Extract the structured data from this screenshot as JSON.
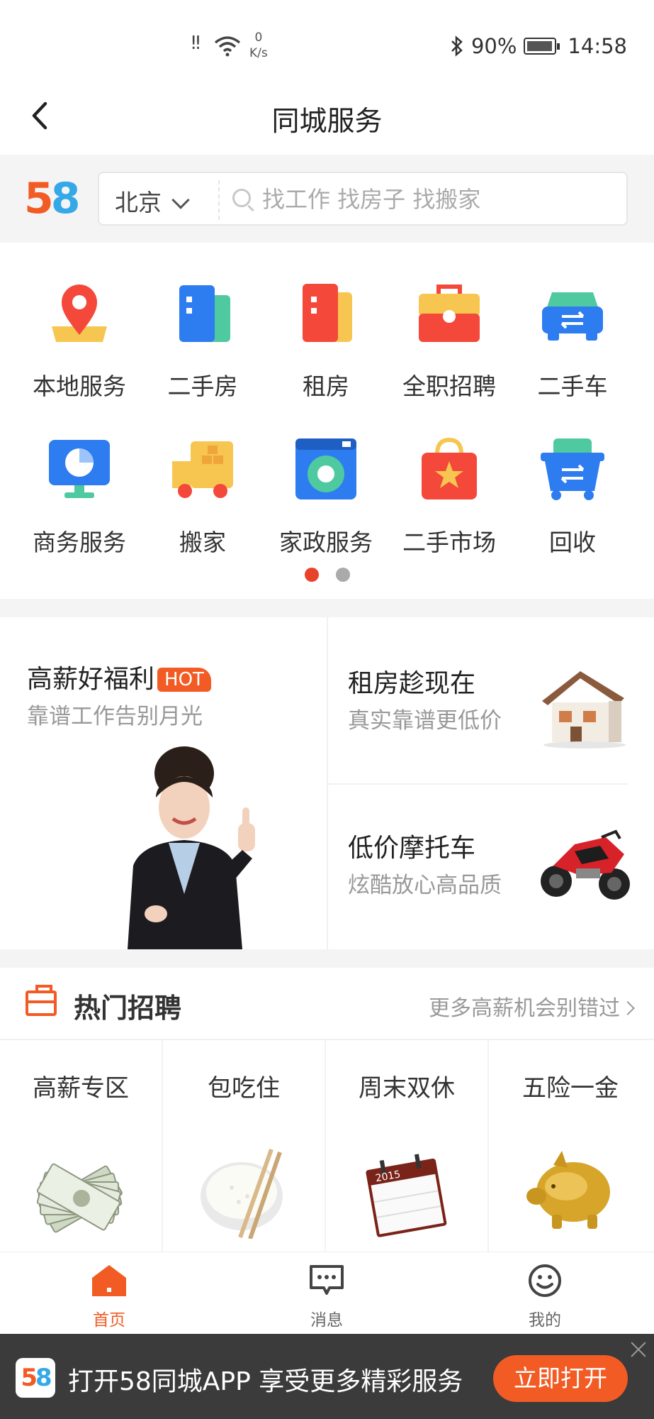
{
  "status_bar": {
    "net": "‼",
    "speed_value": "0",
    "speed_unit": "K/s",
    "battery": "90%",
    "time": "14:58"
  },
  "header": {
    "title": "同城服务"
  },
  "search": {
    "logo": "58",
    "city": "北京",
    "placeholder": "找工作 找房子 找搬家"
  },
  "categories": [
    {
      "label": "本地服务",
      "icon": "location-pin-icon"
    },
    {
      "label": "二手房",
      "icon": "buildings-icon"
    },
    {
      "label": "租房",
      "icon": "rental-building-icon"
    },
    {
      "label": "全职招聘",
      "icon": "briefcase-icon"
    },
    {
      "label": "二手车",
      "icon": "car-icon"
    },
    {
      "label": "商务服务",
      "icon": "monitor-chart-icon"
    },
    {
      "label": "搬家",
      "icon": "moving-truck-icon"
    },
    {
      "label": "家政服务",
      "icon": "washing-machine-icon"
    },
    {
      "label": "二手市场",
      "icon": "shopping-bag-star-icon"
    },
    {
      "label": "回收",
      "icon": "recycle-cart-icon"
    }
  ],
  "pager": {
    "active": 1,
    "total": 2
  },
  "promos": {
    "left": {
      "title": "高薪好福利",
      "badge": "HOT",
      "subtitle": "靠谱工作告别月光"
    },
    "right_top": {
      "title": "租房趁现在",
      "subtitle": "真实靠谱更低价"
    },
    "right_bottom": {
      "title": "低价摩托车",
      "subtitle": "炫酷放心高品质"
    }
  },
  "hot_jobs": {
    "title": "热门招聘",
    "more": "更多高薪机会别错过",
    "items": [
      {
        "label": "高薪专区",
        "icon": "money-icon"
      },
      {
        "label": "包吃住",
        "icon": "rice-bowl-icon"
      },
      {
        "label": "周末双休",
        "icon": "calendar-icon",
        "calendar_year": "2015"
      },
      {
        "label": "五险一金",
        "icon": "piggy-bank-icon"
      }
    ]
  },
  "tabbar": [
    {
      "label": "首页",
      "icon": "home-icon",
      "active": true
    },
    {
      "label": "消息",
      "icon": "message-icon",
      "active": false
    },
    {
      "label": "我的",
      "icon": "smiley-icon",
      "active": false
    }
  ],
  "banner": {
    "logo": "58",
    "text": "打开58同城APP 享受更多精彩服务",
    "button": "立即打开"
  },
  "colors": {
    "accent": "#f25b24",
    "dot_active": "#e8432a",
    "banner_bg": "#3b3b3b"
  }
}
